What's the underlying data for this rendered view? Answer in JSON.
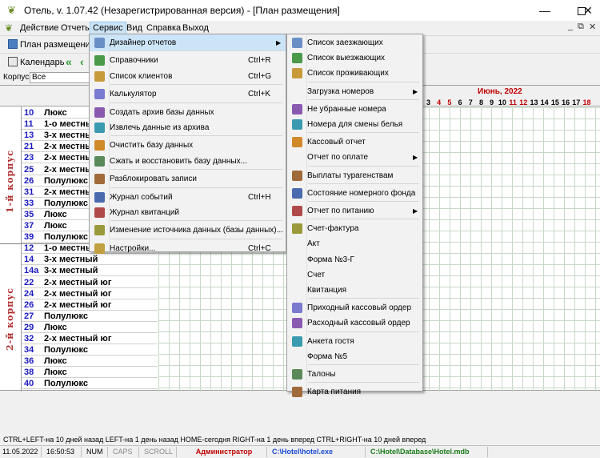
{
  "window": {
    "title": "Отель, v. 1.07.42 (Незарегистрированная версия) - [План размещения]",
    "controls": [
      "minimize-icon",
      "maximize-icon",
      "close-icon"
    ]
  },
  "menubar": {
    "items": [
      {
        "label": "Действие"
      },
      {
        "label": "Отчеты"
      },
      {
        "label": "Сервис"
      },
      {
        "label": "Вид"
      },
      {
        "label": "Справка"
      },
      {
        "label": "Выход"
      }
    ],
    "mdi_controls": {
      "min": "_",
      "restore": "⧉",
      "close": "✕"
    }
  },
  "toolbar": {
    "plan_label": "План размещения",
    "calendar_label": "Календарь",
    "korpus_label": "Корпус",
    "korpus_value": "Все"
  },
  "grid": {
    "month_label": "Июнь, 2022",
    "days": [
      {
        "d": "3",
        "weekend": false
      },
      {
        "d": "4",
        "weekend": true
      },
      {
        "d": "5",
        "weekend": true
      },
      {
        "d": "6",
        "weekend": false
      },
      {
        "d": "7",
        "weekend": false
      },
      {
        "d": "8",
        "weekend": false
      },
      {
        "d": "9",
        "weekend": false
      },
      {
        "d": "10",
        "weekend": false
      },
      {
        "d": "11",
        "weekend": true
      },
      {
        "d": "12",
        "weekend": true
      },
      {
        "d": "13",
        "weekend": false
      },
      {
        "d": "14",
        "weekend": false
      },
      {
        "d": "15",
        "weekend": false
      },
      {
        "d": "16",
        "weekend": false
      },
      {
        "d": "17",
        "weekend": false
      },
      {
        "d": "18",
        "weekend": true
      }
    ],
    "korpus1_label": "1-й корпус",
    "korpus2_label": "2-й корпус",
    "rooms": [
      {
        "num": "10",
        "type": "Люкс"
      },
      {
        "num": "11",
        "type": "1-о местный"
      },
      {
        "num": "13",
        "type": "3-х местный"
      },
      {
        "num": "21",
        "type": "2-х местный"
      },
      {
        "num": "23",
        "type": "2-х местный"
      },
      {
        "num": "25",
        "type": "2-х местный"
      },
      {
        "num": "26",
        "type": "Полулюкс"
      },
      {
        "num": "31",
        "type": "2-х местный"
      },
      {
        "num": "33",
        "type": "Полулюкс"
      },
      {
        "num": "35",
        "type": "Люкс"
      },
      {
        "num": "37",
        "type": "Люкс"
      },
      {
        "num": "39",
        "type": "Полулюкс"
      },
      {
        "num": "12",
        "type": "1-о местный"
      },
      {
        "num": "14",
        "type": "3-х местный"
      },
      {
        "num": "14a",
        "type": "3-х местный"
      },
      {
        "num": "22",
        "type": "2-х местный юг"
      },
      {
        "num": "24",
        "type": "2-х местный юг"
      },
      {
        "num": "26",
        "type": "2-х местный юг"
      },
      {
        "num": "27",
        "type": "Полулюкс"
      },
      {
        "num": "29",
        "type": "Люкс"
      },
      {
        "num": "32",
        "type": "2-х местный юг"
      },
      {
        "num": "34",
        "type": "Полулюкс"
      },
      {
        "num": "36",
        "type": "Люкс"
      },
      {
        "num": "38",
        "type": "Люкс"
      },
      {
        "num": "40",
        "type": "Полулюкс"
      }
    ]
  },
  "service_menu": {
    "items": [
      {
        "label": "Дизайнер отчетов",
        "shortcut": "",
        "icon": "report-designer-icon",
        "submenu": true
      },
      {
        "label": "Справочники",
        "shortcut": "Ctrl+R",
        "icon": "reference-book-icon"
      },
      {
        "label": "Список клиентов",
        "shortcut": "Ctrl+G",
        "icon": "clients-icon"
      },
      {
        "label": "Калькулятор",
        "shortcut": "Ctrl+K",
        "icon": "calculator-icon"
      },
      {
        "label": "Создать архив базы данных",
        "shortcut": "",
        "icon": "archive-create-icon"
      },
      {
        "label": "Извлечь данные из архива",
        "shortcut": "",
        "icon": "archive-extract-icon"
      },
      {
        "label": "Очистить базу данных",
        "shortcut": "",
        "icon": "warning-icon"
      },
      {
        "label": "Сжать и восстановить базу данных...",
        "shortcut": "",
        "icon": "compress-icon"
      },
      {
        "label": "Разблокировать записи",
        "shortcut": "",
        "icon": "unlock-icon"
      },
      {
        "label": "Журнал событий",
        "shortcut": "Ctrl+H",
        "icon": "clock-icon"
      },
      {
        "label": "Журнал квитанций",
        "shortcut": "",
        "icon": "receipts-log-icon"
      },
      {
        "label": "Изменение источника данных (базы данных)...",
        "shortcut": "",
        "icon": "tools-icon"
      },
      {
        "label": "Настройки...",
        "shortcut": "Ctrl+C",
        "icon": "settings-icon"
      }
    ]
  },
  "reports_submenu": {
    "items": [
      {
        "label": "Список заезжающих",
        "icon": "arrivals-icon"
      },
      {
        "label": "Список выезжающих",
        "icon": "departures-icon"
      },
      {
        "label": "Список проживающих",
        "icon": "residents-icon"
      },
      {
        "label": "Загрузка номеров",
        "icon": "",
        "submenu": true
      },
      {
        "label": "Не убранные номера",
        "icon": "cleaning-icon"
      },
      {
        "label": "Номера для смены белья",
        "icon": "linen-icon"
      },
      {
        "label": "Кассовый отчет",
        "icon": "cash-report-icon"
      },
      {
        "label": "Отчет по оплате",
        "icon": "",
        "submenu": true
      },
      {
        "label": "Выплаты турагенствам",
        "icon": "agency-payments-icon"
      },
      {
        "label": "Состояние номерного фонда",
        "icon": "room-fund-icon"
      },
      {
        "label": "Отчет по питанию",
        "icon": "food-report-icon",
        "submenu": true
      },
      {
        "label": "Счет-фактура",
        "icon": "invoice-icon"
      },
      {
        "label": "Акт",
        "icon": ""
      },
      {
        "label": "Форма №3-Г",
        "icon": ""
      },
      {
        "label": "Счет",
        "icon": ""
      },
      {
        "label": "Квитанция",
        "icon": ""
      },
      {
        "label": "Приходный кассовый ордер",
        "icon": "cash-in-icon"
      },
      {
        "label": "Расходный кассовый ордер",
        "icon": "cash-out-icon"
      },
      {
        "label": "Анкета гостя",
        "icon": "guest-form-icon"
      },
      {
        "label": "Форма №5",
        "icon": ""
      },
      {
        "label": "Талоны",
        "icon": "coupons-icon"
      },
      {
        "label": "Карта питания",
        "icon": "meal-card-icon"
      }
    ]
  },
  "hint_bar": "CTRL+LEFT-на 10 дней назад   LEFT-на 1 день назад   HOME-сегодня   RIGHT-на 1 день вперед   CTRL+RIGHT-на 10 дней вперед",
  "statusbar": {
    "date": "11.05.2022",
    "time": "16:50:53",
    "num": "NUM",
    "caps": "CAPS",
    "scroll": "SCROLL",
    "user": "Администратор",
    "exe_path": "C:\\Hotel\\hotel.exe",
    "db_path": "C:\\Hotel\\Database\\Hotel.mdb"
  },
  "colors": {
    "accent_red": "#c00000",
    "room_number_blue": "#1a1ac0",
    "path_blue": "#1a4ad0",
    "db_green": "#1a7a1a",
    "menu_highlight": "#cce4f7"
  }
}
